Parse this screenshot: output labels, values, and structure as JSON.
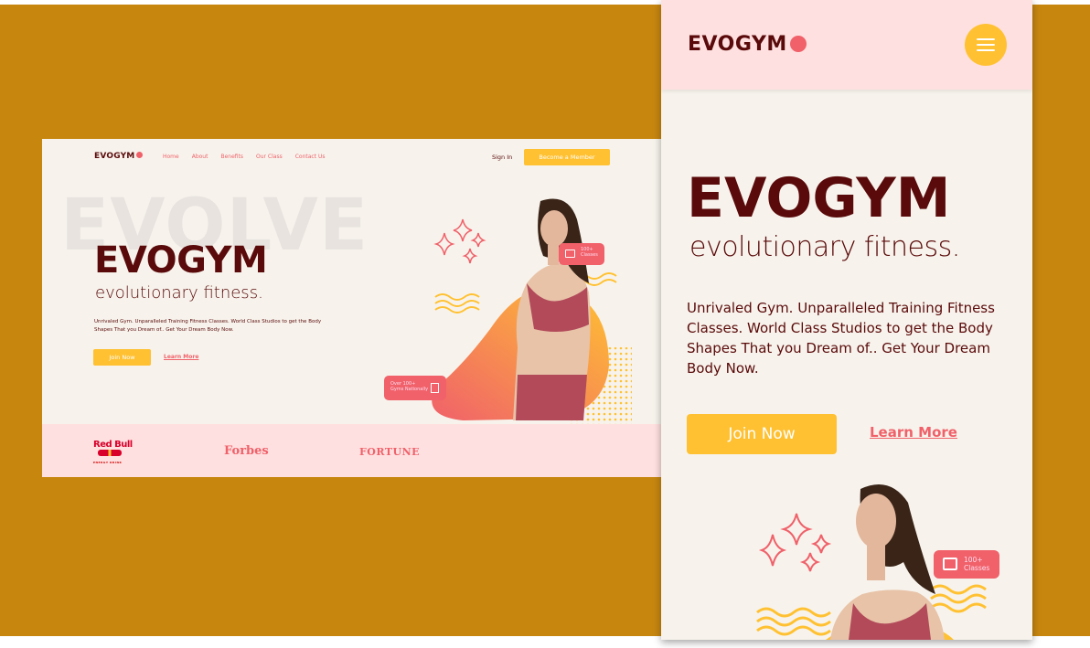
{
  "desktop": {
    "logo": "EVOGYM",
    "nav_links": [
      "Home",
      "About",
      "Benefits",
      "Our Class",
      "Contact Us"
    ],
    "sign_in": "Sign In",
    "member_button": "Become a Member",
    "bg_word": "EVOLVE",
    "title": "EVOGYM",
    "subtitle": "evolutionary fitness.",
    "description": "Unrivaled Gym. Unparalleled Training Fitness Classes. World Class Studios to get the Body Shapes That you Dream of.. Get Your Dream Body Now.",
    "join_button": "Join Now",
    "learn_more": "Learn More",
    "badge_classes_line1": "100+",
    "badge_classes_line2": "Classes",
    "badge_gyms_line1": "Over 100+",
    "badge_gyms_line2": "Gyms Nationally",
    "sponsors": {
      "redbull": "Red Bull",
      "redbull_sub": "ENERGY DRINK",
      "forbes": "Forbes",
      "fortune": "FORTUNE"
    }
  },
  "mobile": {
    "logo": "EVOGYM",
    "title": "EVOGYM",
    "subtitle": "evolutionary fitness.",
    "description": "Unrivaled Gym. Unparalleled Training Fitness Classes. World Class Studios to get the Body Shapes That you Dream of.. Get Your Dream Body Now.",
    "join_button": "Join Now",
    "learn_more": "Learn More",
    "badge_line1": "100+",
    "badge_line2": "Classes"
  },
  "colors": {
    "background": "#c7870f",
    "primary_dark": "#5a0a0a",
    "accent_red": "#f0616a",
    "accent_yellow": "#ffc132",
    "pink": "#ffe0e0",
    "cream": "#f7f3ec"
  }
}
